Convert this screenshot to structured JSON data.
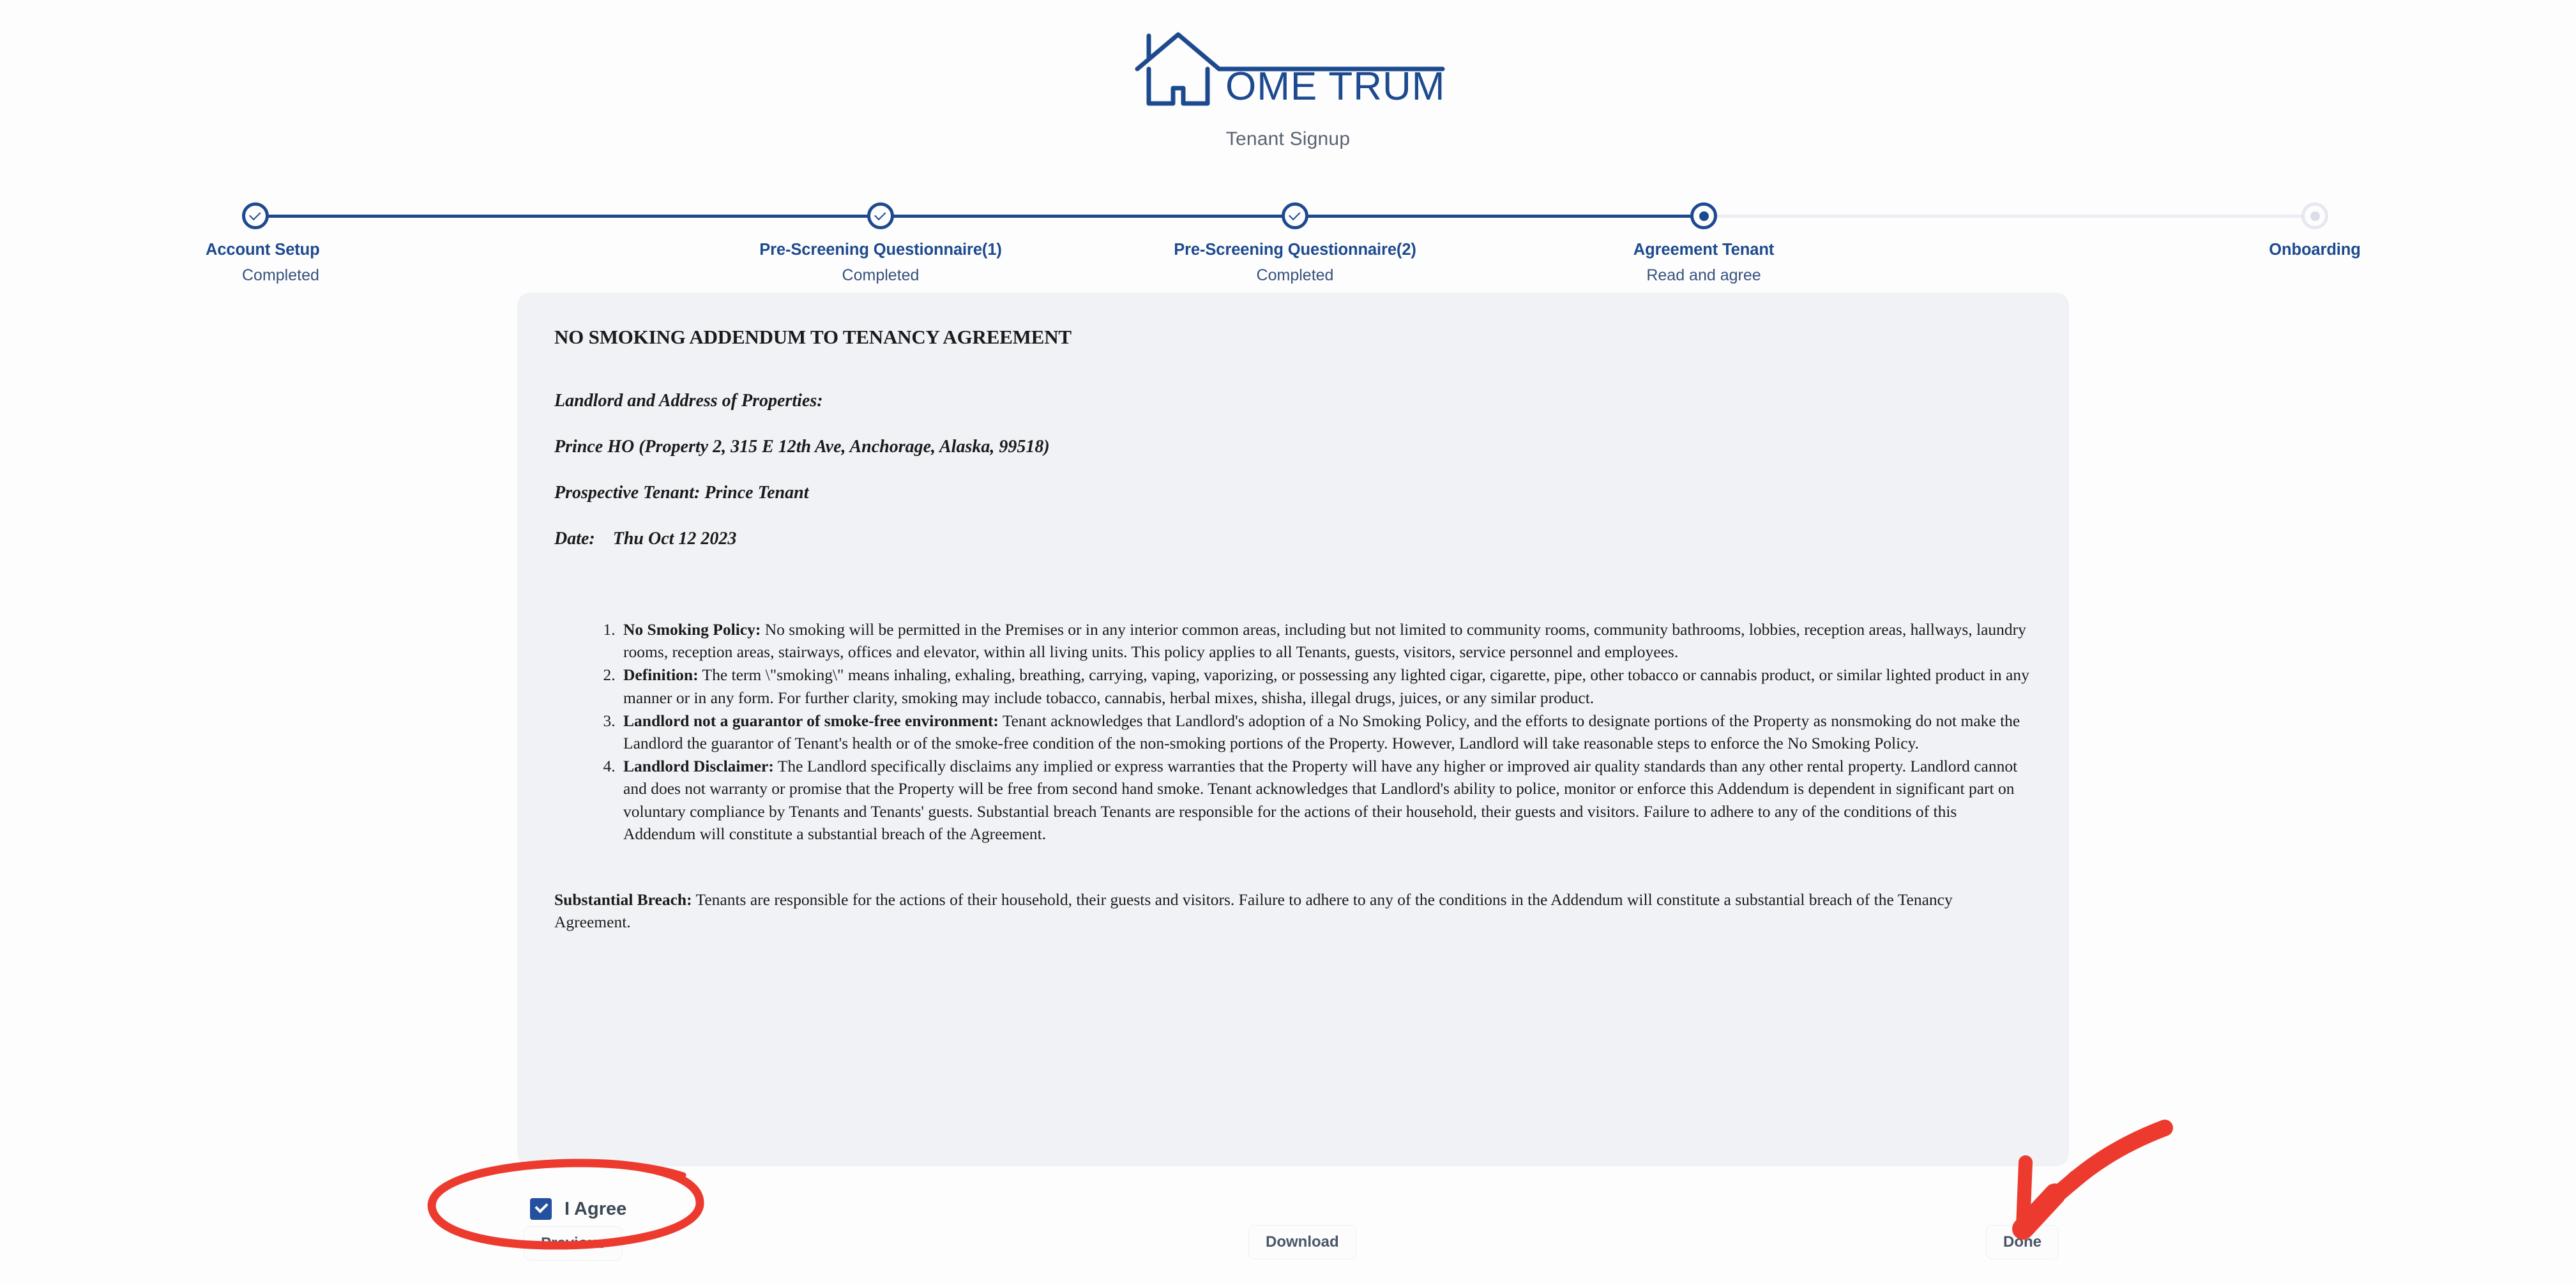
{
  "brand": {
    "logo_text": "OME TRUMPETER",
    "logo_full_name": "HOME TRUMPETER",
    "accent_color": "#1d4a8f"
  },
  "header": {
    "subtitle": "Tenant Signup"
  },
  "stepper": {
    "steps": [
      {
        "label": "Account Setup",
        "status": "Completed",
        "state": "done"
      },
      {
        "label": "Pre-Screening Questionnaire(1)",
        "status": "Completed",
        "state": "done"
      },
      {
        "label": "Pre-Screening Questionnaire(2)",
        "status": "Completed",
        "state": "done"
      },
      {
        "label": "Agreement Tenant",
        "status": "Read and agree",
        "state": "current"
      },
      {
        "label": "Onboarding",
        "status": "",
        "state": "pending"
      }
    ]
  },
  "document": {
    "title": "NO SMOKING ADDENDUM TO TENANCY AGREEMENT",
    "landlord_heading": "Landlord and Address of Properties:",
    "landlord_line": "Prince HO (Property 2, 315 E 12th Ave, Anchorage, Alaska, 99518)",
    "tenant_line": "Prospective Tenant: Prince Tenant",
    "date_line": "Date:    Thu Oct 12 2023",
    "clauses": [
      {
        "heading": "No Smoking Policy:",
        "body": " No smoking will be permitted in the Premises or in any interior common areas, including but not limited to community rooms, community bathrooms, lobbies, reception areas, hallways, laundry rooms, reception areas, stairways, offices and elevator, within all living units. This policy applies to all Tenants, guests, visitors, service personnel and employees."
      },
      {
        "heading": "Definition:",
        "body": " The term \\\"smoking\\\" means inhaling, exhaling, breathing, carrying, vaping, vaporizing, or possessing any lighted cigar, cigarette, pipe, other tobacco or cannabis product, or similar lighted product in any manner or in any form. For further clarity, smoking may include tobacco, cannabis, herbal mixes, shisha, illegal drugs, juices, or any similar product."
      },
      {
        "heading": "Landlord not a guarantor of smoke-free environment:",
        "body": " Tenant acknowledges that Landlord's adoption of a No Smoking Policy, and the efforts to designate portions of the Property as nonsmoking do not make the Landlord the guarantor of Tenant's health or of the smoke-free condition of the non-smoking portions of the Property. However, Landlord will take reasonable steps to enforce the No Smoking Policy."
      },
      {
        "heading": "Landlord Disclaimer:",
        "body": " The Landlord specifically disclaims any implied or express warranties that the Property will have any higher or improved air quality standards than any other rental property. Landlord cannot and does not warranty or promise that the Property will be free from second hand smoke. Tenant acknowledges that Landlord's ability to police, monitor or enforce this Addendum is dependent in significant part on voluntary compliance by Tenants and Tenants' guests. Substantial breach Tenants are responsible for the actions of their household, their guests and visitors. Failure to adhere to any of the conditions of this Addendum will constitute a substantial breach of the Agreement."
      }
    ],
    "closing_heading": "Substantial Breach:",
    "closing_body": " Tenants are responsible for the actions of their household, their guests and visitors. Failure to adhere to any of the conditions in the Addendum will constitute a substantial breach of the Tenancy Agreement."
  },
  "controls": {
    "agree_label": "I Agree",
    "agree_checked": true,
    "previous_label": "Previous",
    "download_label": "Download",
    "done_label": "Done"
  },
  "annotations": {
    "color": "#ec3b2e",
    "ellipse_target": "I Agree checkbox",
    "arrow_target": "Done button"
  }
}
